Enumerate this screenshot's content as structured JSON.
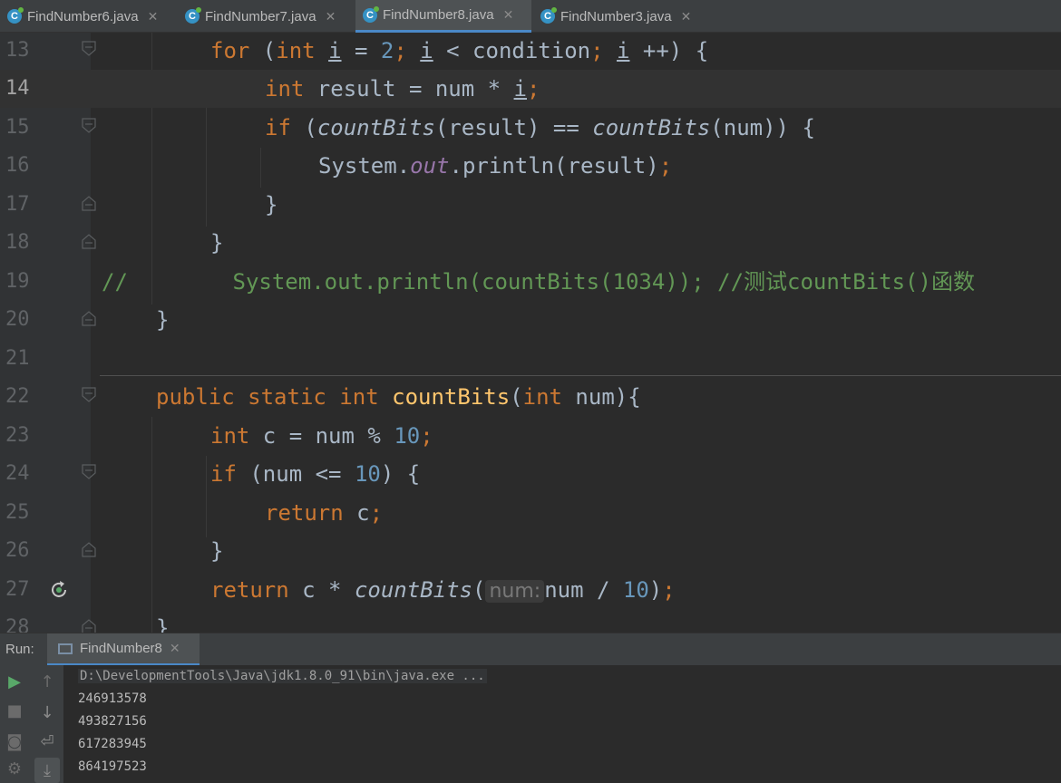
{
  "tabs": [
    {
      "label": "FindNumber6.java",
      "active": false
    },
    {
      "label": "FindNumber7.java",
      "active": false
    },
    {
      "label": "FindNumber8.java",
      "active": true
    },
    {
      "label": "FindNumber3.java",
      "active": false
    }
  ],
  "editor": {
    "current_line": "14",
    "line_numbers": [
      "13",
      "14",
      "15",
      "16",
      "17",
      "18",
      "19",
      "20",
      "21",
      "22",
      "23",
      "24",
      "25",
      "26",
      "27",
      "28"
    ],
    "code": {
      "l13": {
        "kw_for": "for",
        "p1": " (",
        "kw_int": "int",
        "sp1": " ",
        "var_i1": "i",
        "p2": " = ",
        "n2": "2",
        "semi1": ";",
        "sp2": " ",
        "var_i2": "i",
        "p3": " < condition",
        "semi2": ";",
        "sp3": " ",
        "var_i3": "i",
        "p4": " ++) {"
      },
      "l14": {
        "kw_int": "int",
        "p1": " result = num * ",
        "var_i": "i",
        "semi": ";"
      },
      "l15": {
        "kw_if": "if",
        "p1": " (",
        "fn1": "countBits",
        "p2": "(result) == ",
        "fn2": "countBits",
        "p3": "(num)) {"
      },
      "l16": {
        "p1": "System.",
        "field": "out",
        "p2": ".println(result)",
        "semi": ";"
      },
      "l17": {
        "p1": "}"
      },
      "l18": {
        "p1": "}"
      },
      "l19": {
        "comment": "//        System.out.println(countBits(1034)); //测试countBits()函数"
      },
      "l20": {
        "p1": "}"
      },
      "l22": {
        "kw_public": "public",
        "sp1": " ",
        "kw_static": "static",
        "sp2": " ",
        "kw_int": "int",
        "sp3": " ",
        "fn": "countBits",
        "p1": "(",
        "kw_int2": "int",
        "p2": " num){"
      },
      "l23": {
        "kw_int": "int",
        "p1": " c = num % ",
        "n": "10",
        "semi": ";"
      },
      "l24": {
        "kw_if": "if",
        "p1": " (num <= ",
        "n": "10",
        "p2": ") {"
      },
      "l25": {
        "kw_return": "return",
        "p1": " c",
        "semi": ";"
      },
      "l26": {
        "p1": "}"
      },
      "l27": {
        "kw_return": "return",
        "p1": " c * ",
        "fn": "countBits",
        "p2": "(",
        "hint": "num:",
        "p3": "num / ",
        "n": "10",
        "p4": ")",
        "semi": ";"
      },
      "l28": {
        "p1": "}"
      }
    }
  },
  "run": {
    "label": "Run:",
    "tab_label": "FindNumber8",
    "command": "D:\\DevelopmentTools\\Java\\jdk1.8.0_91\\bin\\java.exe ...",
    "output": [
      "246913578",
      "493827156",
      "617283945",
      "864197523"
    ]
  },
  "colors": {
    "background": "#2b2b2b",
    "keyword": "#cc7832",
    "number": "#6897bb",
    "function_decl": "#ffc66d",
    "static_field": "#9876aa",
    "comment": "#629755",
    "accent": "#4a88c7"
  }
}
